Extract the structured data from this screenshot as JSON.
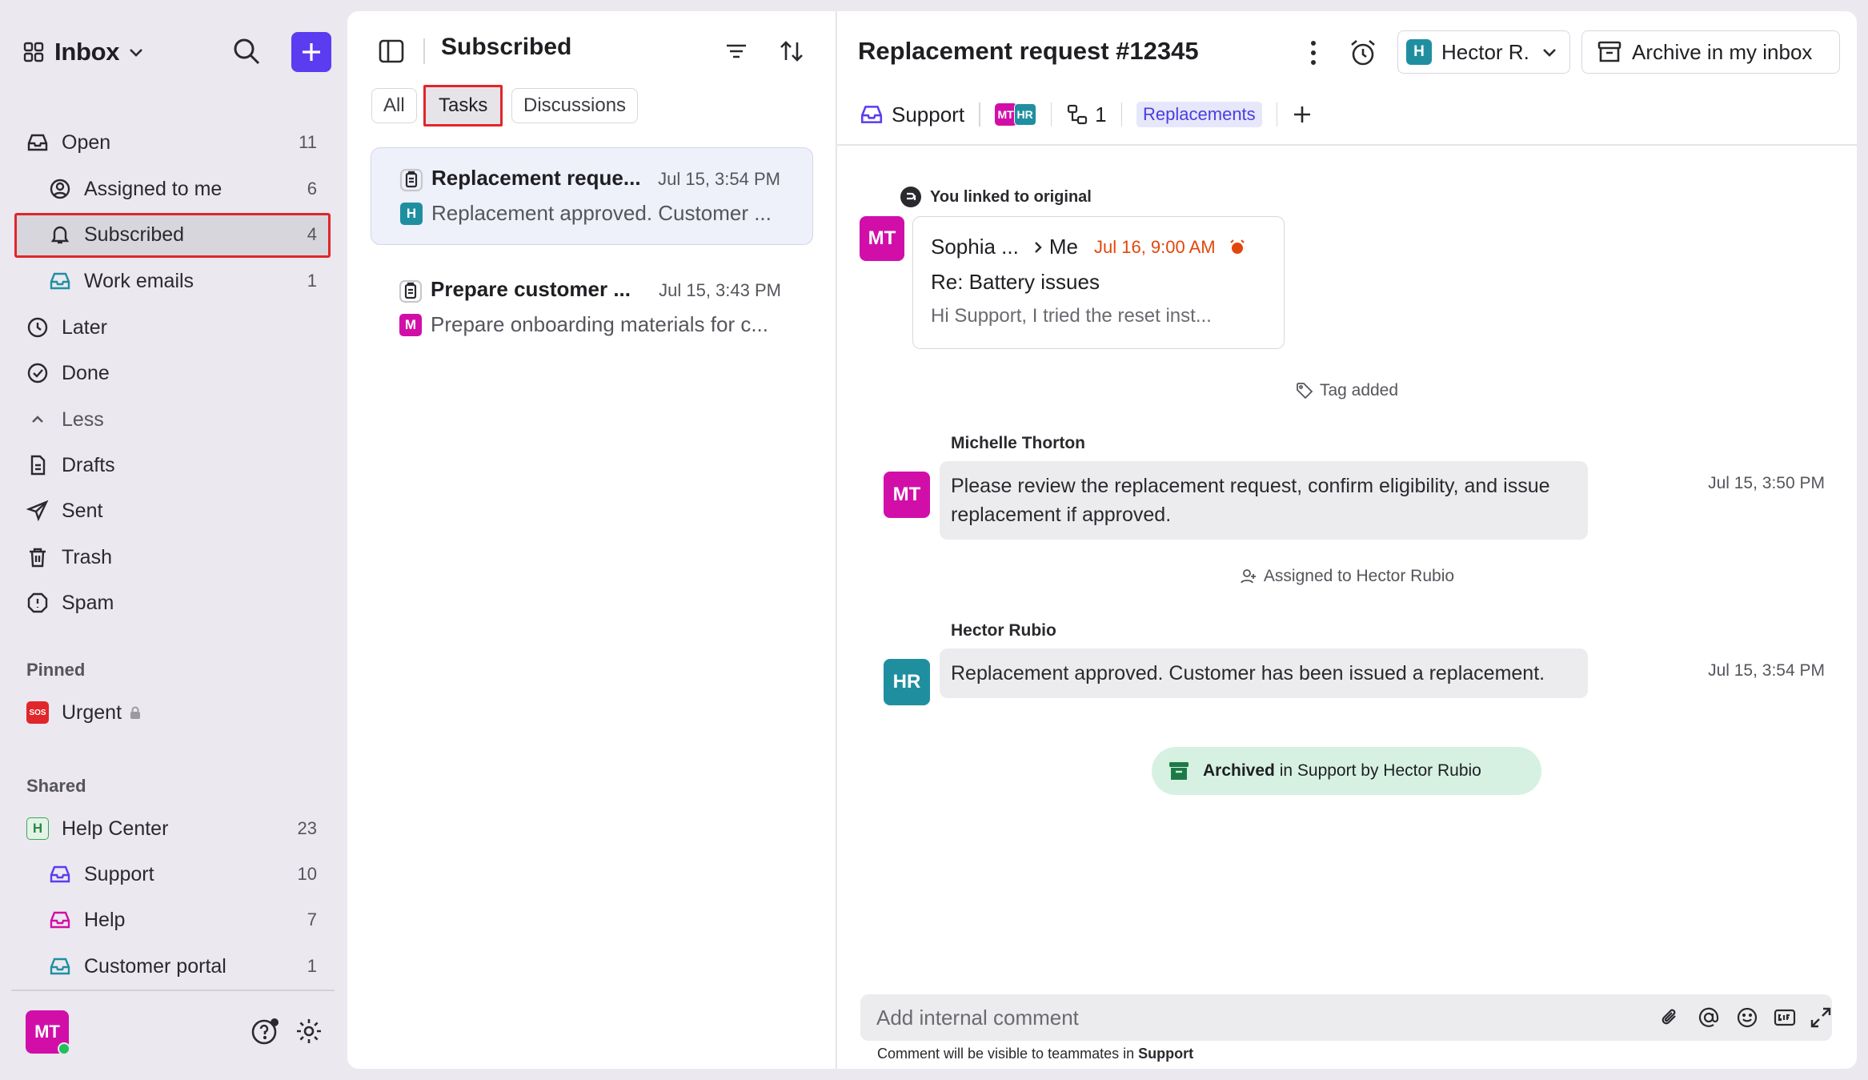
{
  "sidebar": {
    "title": "Inbox",
    "items": [
      {
        "label": "Open",
        "count": "11"
      },
      {
        "label": "Assigned to me",
        "count": "6"
      },
      {
        "label": "Subscribed",
        "count": "4"
      },
      {
        "label": "Work emails",
        "count": "1"
      },
      {
        "label": "Later",
        "count": ""
      },
      {
        "label": "Done",
        "count": ""
      },
      {
        "label": "Less",
        "count": ""
      },
      {
        "label": "Drafts",
        "count": ""
      },
      {
        "label": "Sent",
        "count": ""
      },
      {
        "label": "Trash",
        "count": ""
      },
      {
        "label": "Spam",
        "count": ""
      }
    ],
    "pinned_header": "Pinned",
    "pinned": [
      {
        "label": "Urgent",
        "badge": "SOS"
      }
    ],
    "shared_header": "Shared",
    "shared": [
      {
        "label": "Help Center",
        "count": "23",
        "badge": "H"
      },
      {
        "label": "Support",
        "count": "10"
      },
      {
        "label": "Help",
        "count": "7"
      },
      {
        "label": "Customer portal",
        "count": "1"
      }
    ],
    "user_initials": "MT",
    "colors": {
      "accent": "#5b3cf0",
      "highlight_border": "#e0262a",
      "user": "#d10fa8",
      "online": "#1fbf5a"
    }
  },
  "list": {
    "title": "Subscribed",
    "tabs": [
      "All",
      "Tasks",
      "Discussions"
    ],
    "active_tab": "Tasks",
    "items": [
      {
        "title": "Replacement reque...",
        "time": "Jul 15, 3:54 PM",
        "preview": "Replacement approved. Customer ...",
        "avatar": "H",
        "avatar_color": "#1f8fa0"
      },
      {
        "title": "Prepare customer ...",
        "time": "Jul 15, 3:43 PM",
        "preview": "Prepare onboarding materials for c...",
        "avatar": "M",
        "avatar_color": "#d10fa8"
      }
    ]
  },
  "detail": {
    "title": "Replacement request #12345",
    "assignee": {
      "initial": "H",
      "name": "Hector R."
    },
    "archive_label": "Archive in my inbox",
    "inbox_label": "Support",
    "avatars": [
      "MT",
      "HR"
    ],
    "subtask_count": "1",
    "tag": "Replacements",
    "linked_note": "You linked to original",
    "email": {
      "avatar": "MT",
      "from": "Sophia ...",
      "to": "Me",
      "date": "Jul 16, 9:00 AM",
      "subject": "Re: Battery issues",
      "snippet": "Hi Support, I tried the reset inst..."
    },
    "tag_added": "Tag added",
    "messages": [
      {
        "author": "Michelle Thorton",
        "initials": "MT",
        "color": "#d10fa8",
        "text": "Please review the replacement request, confirm eligibility, and issue replacement if approved.",
        "time": "Jul 15, 3:50 PM"
      },
      {
        "author": "Hector Rubio",
        "initials": "HR",
        "color": "#1f8fa0",
        "text": "Replacement approved. Customer has been issued a replacement.",
        "time": "Jul 15, 3:54 PM"
      }
    ],
    "assigned_note": "Assigned to Hector Rubio",
    "archived": {
      "bold": "Archived",
      "rest": " in Support by Hector Rubio"
    },
    "comment": {
      "placeholder": "Add internal comment",
      "help_prefix": "Comment will be visible to teammates in ",
      "help_inbox": "Support"
    }
  }
}
